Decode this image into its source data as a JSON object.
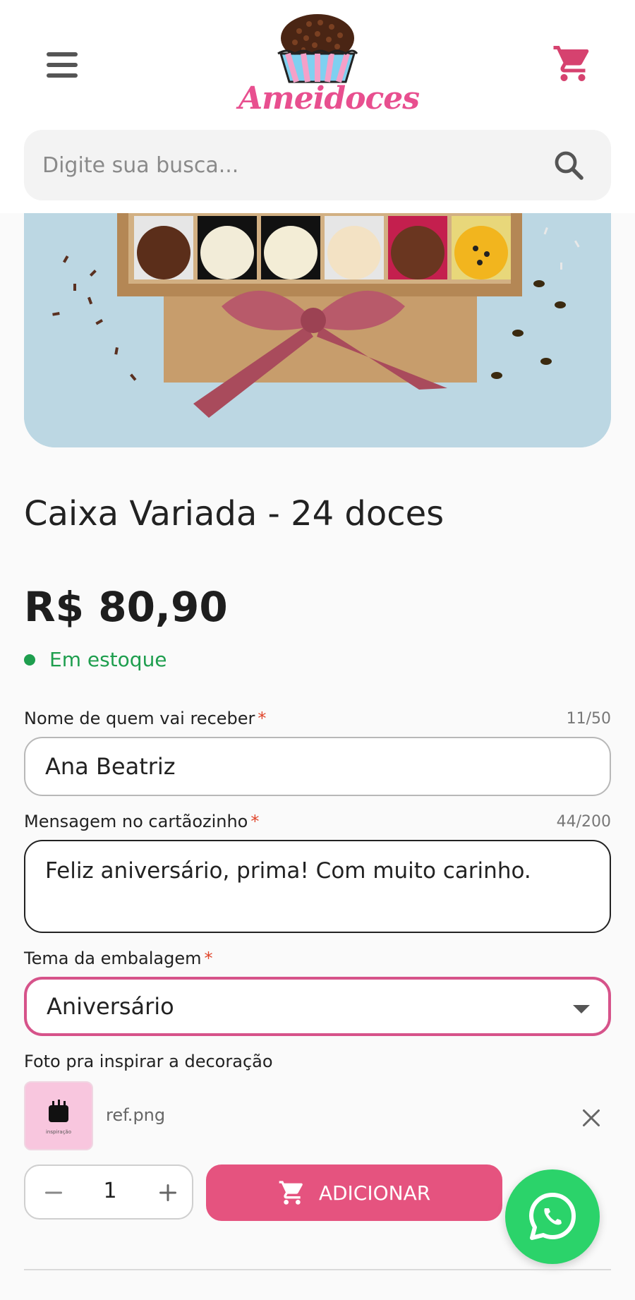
{
  "header": {
    "brand": "Ameidoces",
    "menu_icon": "hamburger-menu-icon",
    "cart_icon": "shopping-cart-icon",
    "brand_color": "#e84f8f"
  },
  "search": {
    "placeholder": "Digite sua busca...",
    "icon": "search-icon"
  },
  "product": {
    "image": "assorted-truffles-box-photo",
    "title": "Caixa Variada - 24 doces",
    "price": "R$ 80,90",
    "stock_status": "Em estoque",
    "stock_color": "#1e9e4e"
  },
  "form": {
    "recipient": {
      "label": "Nome de quem vai receber",
      "required_mark": "*",
      "counter": "11/50",
      "value": "Ana Beatriz"
    },
    "card_message": {
      "label": "Mensagem no cartãozinho",
      "required_mark": "*",
      "counter": "44/200",
      "value": "Feliz aniversário, prima! Com muito carinho."
    },
    "package_theme": {
      "label": "Tema da embalagem",
      "required_mark": "*",
      "selected": "Aniversário",
      "accent": "#d6538a"
    },
    "inspiration_photo": {
      "label": "Foto pra inspirar a decoração",
      "thumbnail_caption": "inspiração",
      "file_name": "ref.png"
    }
  },
  "purchase": {
    "quantity": "1",
    "add_label": "ADICIONAR",
    "button_color": "#e5537f"
  },
  "whatsapp": {
    "icon": "whatsapp-icon",
    "color": "#2bd36a"
  }
}
